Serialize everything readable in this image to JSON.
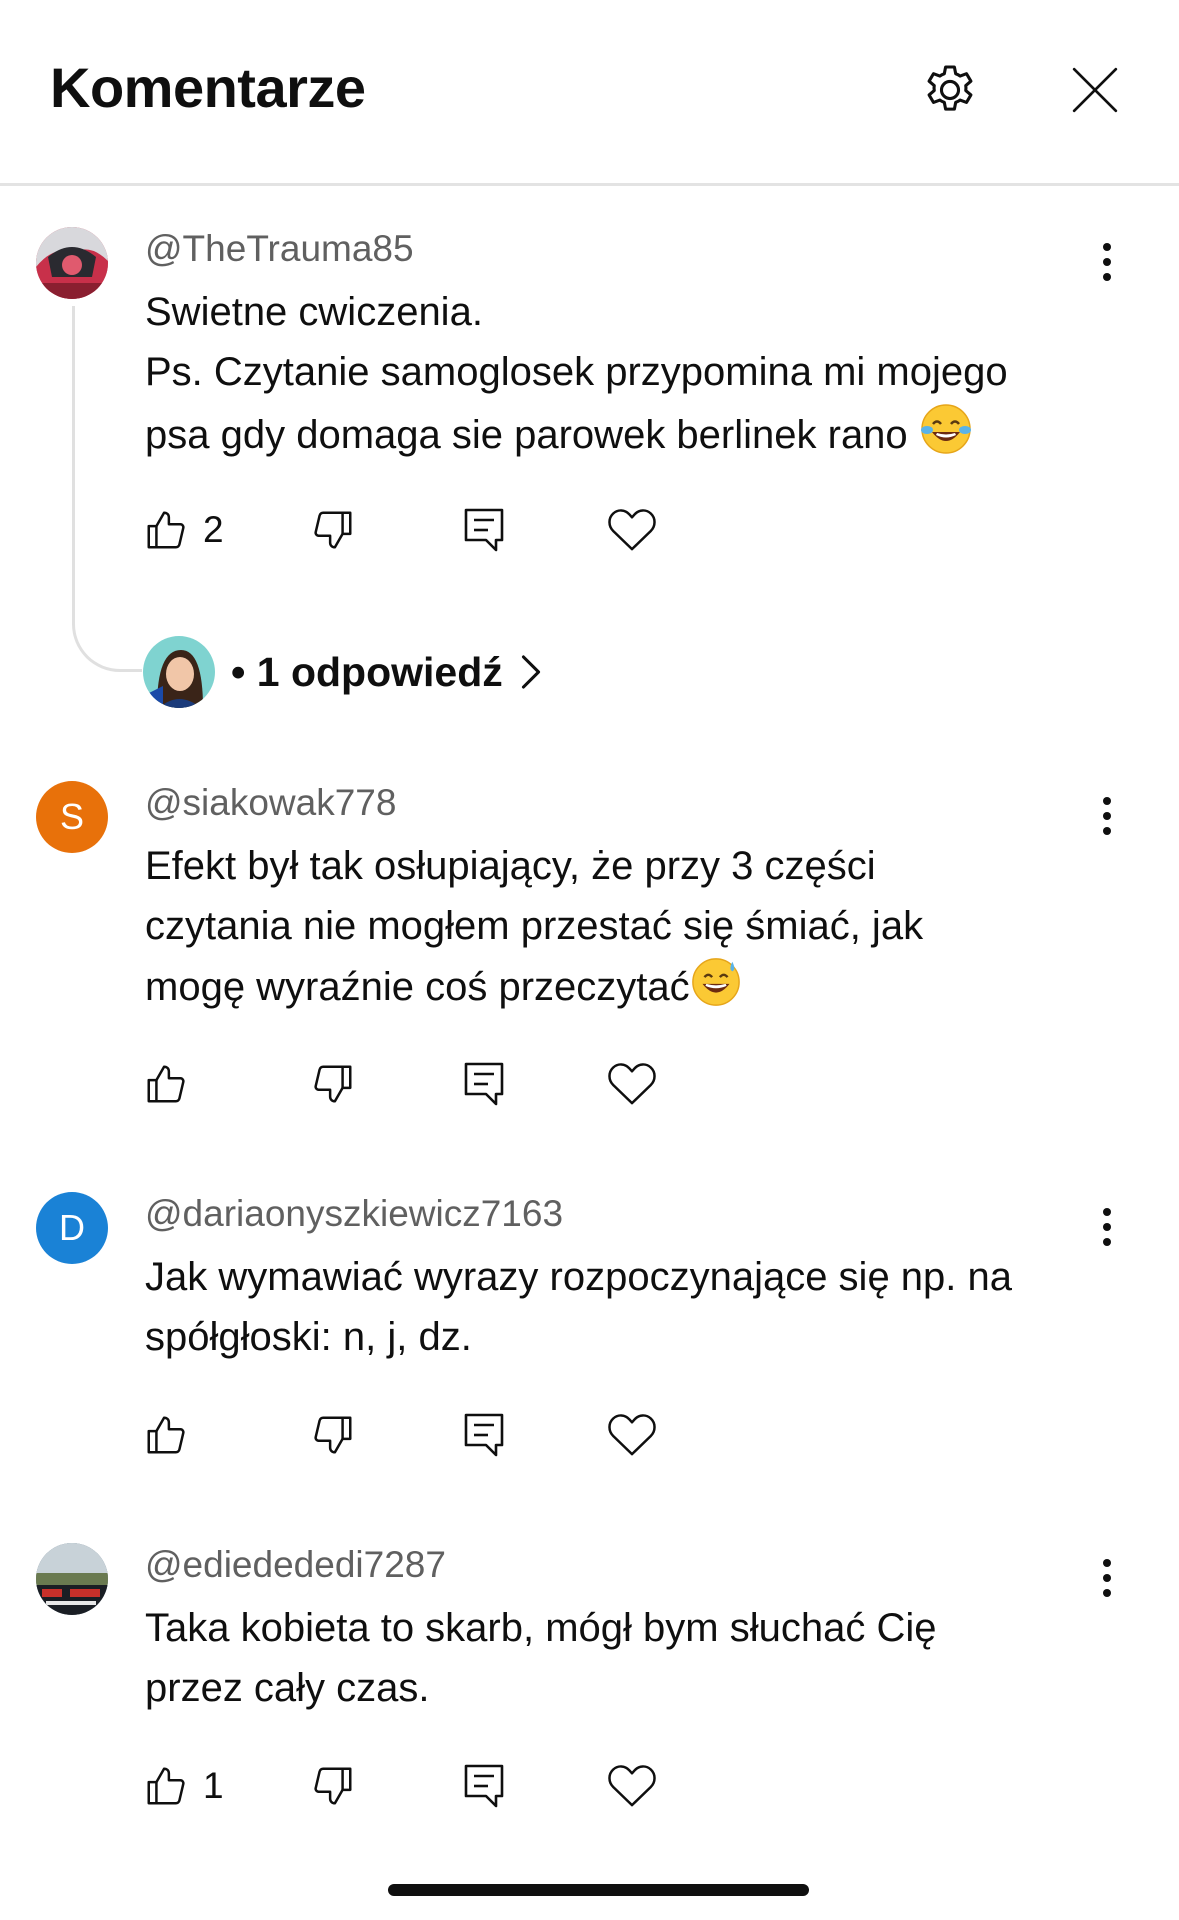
{
  "header": {
    "title": "Komentarze",
    "settings_icon": "gear-icon",
    "close_icon": "close-icon"
  },
  "comments": [
    {
      "author": "@TheTrauma85",
      "text_lines": [
        "Swietne cwiczenia.",
        "Ps. Czytanie samoglosek przypomina mi mojego",
        "psa gdy domaga sie parowek berlinek rano "
      ],
      "emoji": "face-with-tears-of-joy",
      "like_count": "2",
      "avatar_color": "#c8304a",
      "replies": {
        "label": "• 1 odpowiedź"
      }
    },
    {
      "author": "@siakowak778",
      "text_lines": [
        "Efekt był tak osłupiający, że przy 3 części",
        "czytania nie mogłem przestać się śmiać, jak",
        "mogę wyraźnie coś przeczytać"
      ],
      "emoji": "grinning-face-with-sweat",
      "avatar_letter": "S",
      "avatar_color": "#e8710a",
      "like_count": ""
    },
    {
      "author": "@dariaonyszkiewicz7163",
      "text_lines": [
        "Jak wymawiać wyrazy rozpoczynające się np. na",
        "spółgłoski: n, j, dz."
      ],
      "avatar_letter": "D",
      "avatar_color": "#1a82d6",
      "like_count": ""
    },
    {
      "author": "@ediedededi7287",
      "text_lines": [
        "Taka kobieta to skarb, mógł bym słuchać Cię",
        "przez cały czas."
      ],
      "avatar_color": "#3a4a5a",
      "like_count": "1"
    }
  ],
  "colors": {
    "text_primary": "#0f0f0f",
    "text_secondary": "#606060",
    "divider": "#e3e3e3"
  }
}
